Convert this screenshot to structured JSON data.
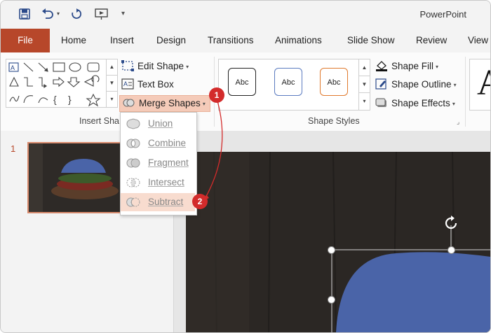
{
  "app": {
    "title": "PowerPoint"
  },
  "qat": {
    "save_icon": "save-icon",
    "undo_icon": "undo-icon",
    "redo_icon": "redo-icon",
    "present_icon": "present-from-start-icon",
    "customize_icon": "customize-qat-icon"
  },
  "tabs": [
    {
      "label": "File"
    },
    {
      "label": "Home"
    },
    {
      "label": "Insert"
    },
    {
      "label": "Design"
    },
    {
      "label": "Transitions"
    },
    {
      "label": "Animations"
    },
    {
      "label": "Slide Show"
    },
    {
      "label": "Review"
    },
    {
      "label": "View"
    }
  ],
  "ribbon": {
    "edit_shape": "Edit Shape",
    "text_box": "Text Box",
    "merge_shapes": "Merge Shapes",
    "insert_shapes_group": "Insert Sha",
    "shape_styles_group": "Shape Styles",
    "style_tile_label": "Abc",
    "shape_fill": "Shape Fill",
    "shape_outline": "Shape Outline",
    "shape_effects": "Shape Effects",
    "wordart_letter": "A"
  },
  "merge_menu": {
    "items": [
      {
        "label": "Union",
        "icon": "union-icon"
      },
      {
        "label": "Combine",
        "icon": "combine-icon"
      },
      {
        "label": "Fragment",
        "icon": "fragment-icon"
      },
      {
        "label": "Intersect",
        "icon": "intersect-icon"
      },
      {
        "label": "Subtract",
        "icon": "subtract-icon",
        "highlighted": true
      }
    ]
  },
  "annotations": {
    "step1": "1",
    "step2": "2"
  },
  "slides": {
    "current_number": "1"
  },
  "colors": {
    "accent": "#b7472a",
    "badge": "#d32b2b",
    "selection": "#f5cbb9",
    "shape_blue": "#4a64a8"
  }
}
